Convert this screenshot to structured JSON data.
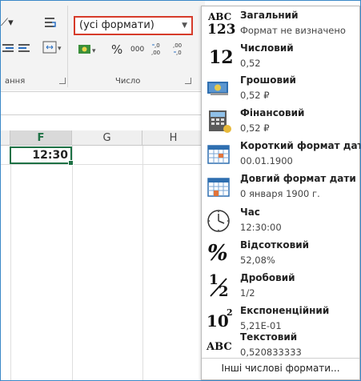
{
  "ribbon": {
    "number_format_value": "(усі формати)",
    "percent_symbol": "%",
    "thousands_label": "000",
    "increase_decimal_label": ",00 ,0",
    "decrease_decimal_label": ",00 ,0",
    "alignment_group_label": "ання",
    "number_group_label": "Число"
  },
  "grid": {
    "columns": [
      "F",
      "G",
      "H"
    ],
    "selected_cell_value": "12:30"
  },
  "dropdown": {
    "items": [
      {
        "name": "Загальний",
        "sample": "Формат не визначено",
        "icon": "general-abc123-icon",
        "icon_text": [
          "ABC",
          "123"
        ]
      },
      {
        "name": "Числовий",
        "sample": "0,52",
        "icon": "number-12-icon",
        "icon_text": "12"
      },
      {
        "name": "Грошовий",
        "sample": "0,52 ₽",
        "icon": "currency-icon"
      },
      {
        "name": "Фінансовий",
        "sample": "0,52 ₽",
        "icon": "accounting-icon"
      },
      {
        "name": "Короткий формат дати",
        "sample": "00.01.1900",
        "icon": "calendar-short-icon"
      },
      {
        "name": "Довгий формат дати",
        "sample": "0 января 1900 г.",
        "icon": "calendar-long-icon"
      },
      {
        "name": "Час",
        "sample": "12:30:00",
        "icon": "clock-icon"
      },
      {
        "name": "Відсотковий",
        "sample": "52,08%",
        "icon": "percent-icon",
        "icon_text": "%"
      },
      {
        "name": "Дробовий",
        "sample": "1/2",
        "icon": "fraction-icon",
        "icon_text": [
          "1",
          "2"
        ]
      },
      {
        "name": "Експоненційний",
        "sample": "5,21E-01",
        "icon": "scientific-icon",
        "icon_text": [
          "10",
          "2"
        ]
      },
      {
        "name": "Текстовий",
        "sample": "0,520833333",
        "icon": "text-abc-icon",
        "icon_text": "ABC"
      }
    ],
    "more_label": "Інші числові формати..."
  },
  "colors": {
    "frame_border": "#3a88c8",
    "combo_highlight": "#d63b2a",
    "selection_green": "#1e7145"
  }
}
